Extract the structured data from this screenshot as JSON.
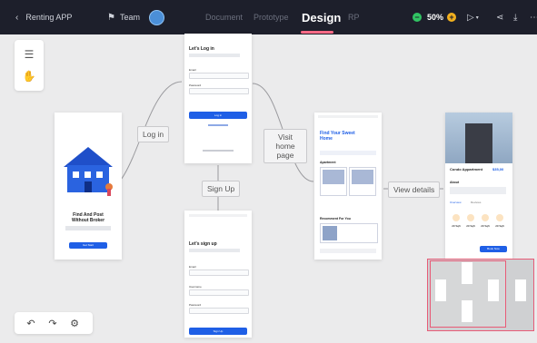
{
  "topbar": {
    "back_icon": "chevron-left-icon",
    "project_name": "Renting APP",
    "team_icon": "team-icon",
    "team_label": "Team",
    "tabs": [
      {
        "label": "Document",
        "active": false
      },
      {
        "label": "Prototype",
        "active": false
      },
      {
        "label": "Design",
        "active": true
      },
      {
        "label": "RP",
        "active": false
      }
    ],
    "zoom": "50%",
    "accent": "#ff6a86"
  },
  "flow_labels": {
    "log_in": "Log in",
    "sign_up": "Sign Up",
    "visit_home": "Visit home page",
    "view_details": "View details"
  },
  "screens": {
    "onboarding": {
      "title": "Find And Post Without Broker",
      "button": "Get Start"
    },
    "login": {
      "title": "Let's Log in",
      "email_label": "Email",
      "password_label": "Password",
      "button": "Log in"
    },
    "signup": {
      "title": "Let's sign up",
      "email_label": "Email",
      "username_label": "Username",
      "password_label": "Password",
      "button": "Sign Up"
    },
    "home": {
      "title": "Find Your Sweet Home",
      "section_apartment": "Apartment",
      "section_recommend": "Recomment For You"
    },
    "detail": {
      "name": "Condo Appartment",
      "price": "$35,00",
      "section_about": "About",
      "tab_overview": "Overview",
      "tab_reviews": "Reviews",
      "stats": [
        "20 Sqft",
        "20 Sqft",
        "20 Sqft",
        "20 Sqft"
      ],
      "button": "Book Now"
    }
  },
  "colors": {
    "primary": "#1f5fe6",
    "minimap_border": "#e85b77"
  }
}
